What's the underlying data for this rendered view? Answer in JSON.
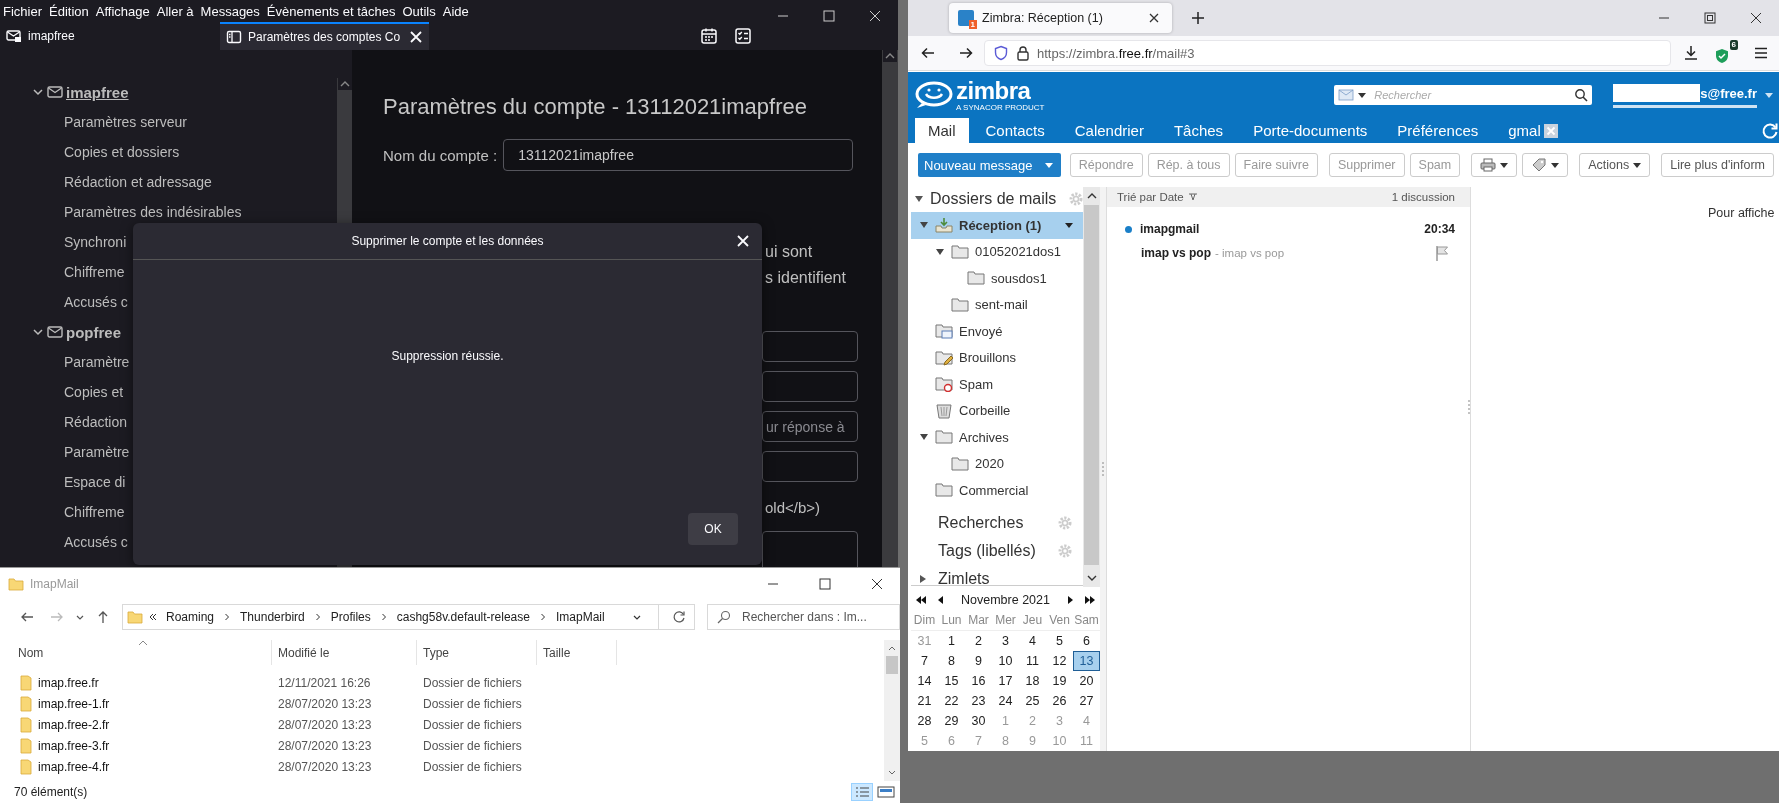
{
  "thunderbird": {
    "menu": [
      "Fichier",
      "Édition",
      "Affichage",
      "Aller à",
      "Messages",
      "Évènements et tâches",
      "Outils",
      "Aide"
    ],
    "tabs": [
      {
        "label": "imapfree",
        "selected": false
      },
      {
        "label": "Paramètres des comptes Co",
        "selected": true
      }
    ],
    "accounts": [
      {
        "name": "imapfree",
        "selected": true,
        "expanded": true,
        "children": [
          "Paramètres serveur",
          "Copies et dossiers",
          "Rédaction et adressage",
          "Paramètres des indésirables",
          "Synchroni",
          "Chiffreme",
          "Accusés c"
        ]
      },
      {
        "name": "popfree",
        "selected": false,
        "expanded": true,
        "children": [
          "Paramètre",
          "Copies et",
          "Rédaction",
          "Paramètre",
          "Espace di",
          "Chiffreme",
          "Accusés c"
        ]
      }
    ],
    "heading": "Paramètres du compte - 13112021imapfree",
    "account_name": {
      "label": "Nom du compte :",
      "value": "13112021imapfree"
    },
    "identity_lines": [
      "ui sont",
      "s identifient"
    ],
    "reply_placeholder": "ur réponse à",
    "signature_note": "old</b>)",
    "dialog": {
      "title": "Supprimer le compte et les données",
      "message": "Suppression réussie.",
      "button": "OK"
    }
  },
  "browser": {
    "tab": "Zimbra: Réception (1)",
    "favicon_badge": "1",
    "url": "https://zimbra.**free.fr**/mail#3",
    "extension_badge": "6"
  },
  "zimbra": {
    "logo": "zimbra",
    "tagline": "A SYNACOR PRODUCT",
    "search_placeholder": "Rechercher",
    "user": "s@free.fr",
    "tabs": [
      {
        "label": "Mail",
        "selected": true,
        "closable": false
      },
      {
        "label": "Contacts",
        "selected": false,
        "closable": false
      },
      {
        "label": "Calendrier",
        "selected": false,
        "closable": false
      },
      {
        "label": "Tâches",
        "selected": false,
        "closable": false
      },
      {
        "label": "Porte-documents",
        "selected": false,
        "closable": false
      },
      {
        "label": "Préférences",
        "selected": false,
        "closable": false
      },
      {
        "label": "gmal",
        "selected": false,
        "closable": true
      }
    ],
    "new_message": "Nouveau message",
    "toolbar": [
      {
        "kind": "button",
        "label": "Répondre",
        "disabled": true
      },
      {
        "kind": "button",
        "label": "Rép. à tous",
        "disabled": true
      },
      {
        "kind": "button",
        "label": "Faire suivre",
        "disabled": true
      },
      {
        "kind": "button",
        "label": "Supprimer",
        "disabled": true
      },
      {
        "kind": "button",
        "label": "Spam",
        "disabled": true
      },
      {
        "kind": "print",
        "disabled": false
      },
      {
        "kind": "tag",
        "disabled": false
      },
      {
        "kind": "menu",
        "label": "Actions",
        "disabled": false
      },
      {
        "kind": "button",
        "label": "Lire plus d'inform",
        "disabled": false
      }
    ],
    "folders_title": "Dossiers de mails",
    "folders": [
      {
        "name": "Réception (1)",
        "kind": "inbox",
        "selected": true,
        "expanded": true,
        "children": [
          {
            "name": "01052021dos1",
            "kind": "folder",
            "selected": false,
            "expanded": true,
            "children": [
              {
                "name": "sousdos1",
                "kind": "folder",
                "selected": false
              }
            ]
          },
          {
            "name": "sent-mail",
            "kind": "folder",
            "selected": false
          }
        ]
      },
      {
        "name": "Envoyé",
        "kind": "sent",
        "selected": false
      },
      {
        "name": "Brouillons",
        "kind": "drafts",
        "selected": false
      },
      {
        "name": "Spam",
        "kind": "spam",
        "selected": false
      },
      {
        "name": "Corbeille",
        "kind": "trash",
        "selected": false
      },
      {
        "name": "Archives",
        "kind": "folder",
        "selected": false,
        "expanded": true,
        "children": [
          {
            "name": "2020",
            "kind": "folder",
            "selected": false
          }
        ]
      },
      {
        "name": "Commercial",
        "kind": "folder",
        "selected": false
      }
    ],
    "sections": [
      {
        "label": "Recherches",
        "kind": "gear"
      },
      {
        "label": "Tags (libellés)",
        "kind": "gear"
      },
      {
        "label": "Zimlets",
        "kind": "collapsed"
      }
    ],
    "calendar": {
      "month": "Novembre 2021",
      "weekdays": [
        "Dim",
        "Lun",
        "Mar",
        "Mer",
        "Jeu",
        "Ven",
        "Sam"
      ],
      "days": [
        {
          "d": "31",
          "outside": true,
          "selected": false
        },
        {
          "d": "1",
          "outside": false,
          "selected": false
        },
        {
          "d": "2",
          "outside": false,
          "selected": false
        },
        {
          "d": "3",
          "outside": false,
          "selected": false
        },
        {
          "d": "4",
          "outside": false,
          "selected": false
        },
        {
          "d": "5",
          "outside": false,
          "selected": false
        },
        {
          "d": "6",
          "outside": false,
          "selected": false
        },
        {
          "d": "7",
          "outside": false,
          "selected": false
        },
        {
          "d": "8",
          "outside": false,
          "selected": false
        },
        {
          "d": "9",
          "outside": false,
          "selected": false
        },
        {
          "d": "10",
          "outside": false,
          "selected": false
        },
        {
          "d": "11",
          "outside": false,
          "selected": false
        },
        {
          "d": "12",
          "outside": false,
          "selected": false
        },
        {
          "d": "13",
          "outside": false,
          "selected": true
        },
        {
          "d": "14",
          "outside": false,
          "selected": false
        },
        {
          "d": "15",
          "outside": false,
          "selected": false
        },
        {
          "d": "16",
          "outside": false,
          "selected": false
        },
        {
          "d": "17",
          "outside": false,
          "selected": false
        },
        {
          "d": "18",
          "outside": false,
          "selected": false
        },
        {
          "d": "19",
          "outside": false,
          "selected": false
        },
        {
          "d": "20",
          "outside": false,
          "selected": false
        },
        {
          "d": "21",
          "outside": false,
          "selected": false
        },
        {
          "d": "22",
          "outside": false,
          "selected": false
        },
        {
          "d": "23",
          "outside": false,
          "selected": false
        },
        {
          "d": "24",
          "outside": false,
          "selected": false
        },
        {
          "d": "25",
          "outside": false,
          "selected": false
        },
        {
          "d": "26",
          "outside": false,
          "selected": false
        },
        {
          "d": "27",
          "outside": false,
          "selected": false
        },
        {
          "d": "28",
          "outside": false,
          "selected": false
        },
        {
          "d": "29",
          "outside": false,
          "selected": false
        },
        {
          "d": "30",
          "outside": false,
          "selected": false
        },
        {
          "d": "1",
          "outside": true,
          "selected": false
        },
        {
          "d": "2",
          "outside": true,
          "selected": false
        },
        {
          "d": "3",
          "outside": true,
          "selected": false
        },
        {
          "d": "4",
          "outside": true,
          "selected": false
        },
        {
          "d": "5",
          "outside": true,
          "selected": false
        },
        {
          "d": "6",
          "outside": true,
          "selected": false
        },
        {
          "d": "7",
          "outside": true,
          "selected": false
        },
        {
          "d": "8",
          "outside": true,
          "selected": false
        },
        {
          "d": "9",
          "outside": true,
          "selected": false
        },
        {
          "d": "10",
          "outside": true,
          "selected": false
        },
        {
          "d": "11",
          "outside": true,
          "selected": false
        }
      ]
    },
    "list": {
      "sort": "Trié par Date",
      "count": "1 discussion",
      "messages": [
        {
          "sender": "imapgmail",
          "time": "20:34",
          "subject": "imap vs pop",
          "fragment": "- imap vs pop",
          "unread": true
        }
      ]
    },
    "reading_hint": "Pour affiche"
  },
  "explorer": {
    "title": "ImapMail",
    "path": [
      "Roaming",
      "Thunderbird",
      "Profiles",
      "cashg58v.default-release",
      "ImapMail"
    ],
    "search_placeholder": "Rechercher dans : Im...",
    "columns": [
      "Nom",
      "Modifié le",
      "Type",
      "Taille"
    ],
    "rows": [
      {
        "name": "imap.free.fr",
        "modified": "12/11/2021 16:26",
        "type": "Dossier de fichiers"
      },
      {
        "name": "imap.free-1.fr",
        "modified": "28/07/2020 13:23",
        "type": "Dossier de fichiers"
      },
      {
        "name": "imap.free-2.fr",
        "modified": "28/07/2020 13:23",
        "type": "Dossier de fichiers"
      },
      {
        "name": "imap.free-3.fr",
        "modified": "28/07/2020 13:23",
        "type": "Dossier de fichiers"
      },
      {
        "name": "imap.free-4.fr",
        "modified": "28/07/2020 13:23",
        "type": "Dossier de fichiers"
      }
    ],
    "status": "70 élément(s)"
  }
}
